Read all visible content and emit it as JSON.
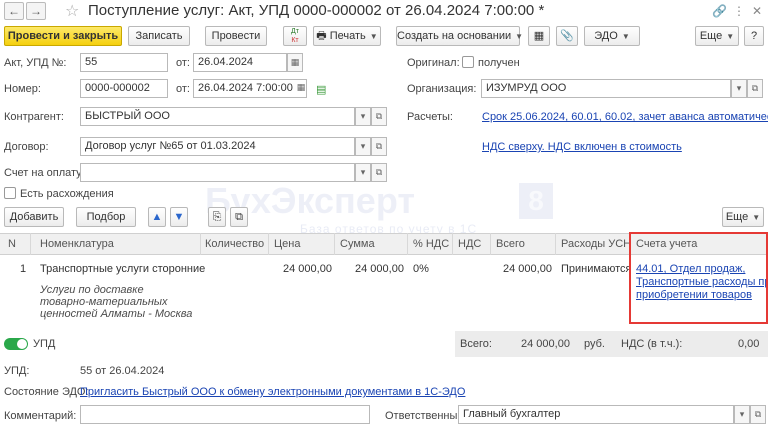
{
  "title": "Поступление услуг: Акт, УПД 0000-000002 от 26.04.2024 7:00:00 *",
  "toolbar": {
    "post_close": "Провести и закрыть",
    "save": "Записать",
    "post": "Провести",
    "print": "Печать",
    "create_based": "Создать на основании",
    "edo": "ЭДО",
    "more": "Еще",
    "help": "?"
  },
  "header": {
    "act_label": "Акт, УПД №:",
    "act_number": "55",
    "from_label": "от:",
    "act_date": "26.04.2024",
    "number_label": "Номер:",
    "number": "0000-000002",
    "from_label2": "от:",
    "doc_datetime": "26.04.2024  7:00:00",
    "original_label": "Оригинал:",
    "received_label": "получен",
    "org_label": "Организация:",
    "org": "ИЗУМРУД ООО",
    "contractor_label": "Контрагент:",
    "contractor": "БЫСТРЫЙ ООО",
    "settlements_label": "Расчеты:",
    "settlements_link": "Срок 25.06.2024, 60.01, 60.02, зачет аванса автоматически",
    "contract_label": "Договор:",
    "contract": "Договор услуг №65 от 01.03.2024",
    "vat_link": "НДС сверху. НДС включен в стоимость",
    "invoice_label": "Счет на оплату:",
    "invoice": "",
    "discrepancy_label": "Есть расхождения"
  },
  "table_toolbar": {
    "add": "Добавить",
    "select": "Подбор",
    "more": "Еще"
  },
  "watermark": {
    "text": "БухЭксперт",
    "badge": "8",
    "sub": "База ответов по учету в 1С"
  },
  "table": {
    "columns": [
      "N",
      "Номенклатура",
      "Количество",
      "Цена",
      "Сумма",
      "% НДС",
      "НДС",
      "Всего",
      "Расходы УСН",
      "Счета учета"
    ],
    "row": {
      "n": "1",
      "name": "Транспортные услуги сторонние",
      "qty": "",
      "price": "24 000,00",
      "sum": "24 000,00",
      "vat_rate": "0%",
      "vat": "",
      "total": "24 000,00",
      "usn": "Принимаются",
      "account_line1": "44.01, Отдел продаж,",
      "account_line2": "Транспортные расходы при",
      "account_line3": "приобретении товаров",
      "desc_line1": "Услуги по доставке",
      "desc_line2": "товарно-материальных",
      "desc_line3": "ценностей Алматы - Москва"
    }
  },
  "footer": {
    "upd_toggle_label": "УПД",
    "total_label": "Всего:",
    "total_value": "24 000,00",
    "currency": "руб.",
    "vat_incl_label": "НДС (в т.ч.):",
    "vat_incl_value": "0,00",
    "upd_label": "УПД:",
    "upd_value": "55 от 26.04.2024",
    "edo_state_label": "Состояние ЭДО:",
    "edo_link": "Пригласить Быстрый ООО к обмену электронными документами в 1С-ЭДО",
    "comment_label": "Комментарий:",
    "comment": "",
    "responsible_label": "Ответственный:",
    "responsible": "Главный бухгалтер"
  },
  "colors": {
    "primary_button": "#f5d00f",
    "link": "#1a44b3",
    "highlight": "#e53935",
    "toggle": "#2aa84a"
  }
}
